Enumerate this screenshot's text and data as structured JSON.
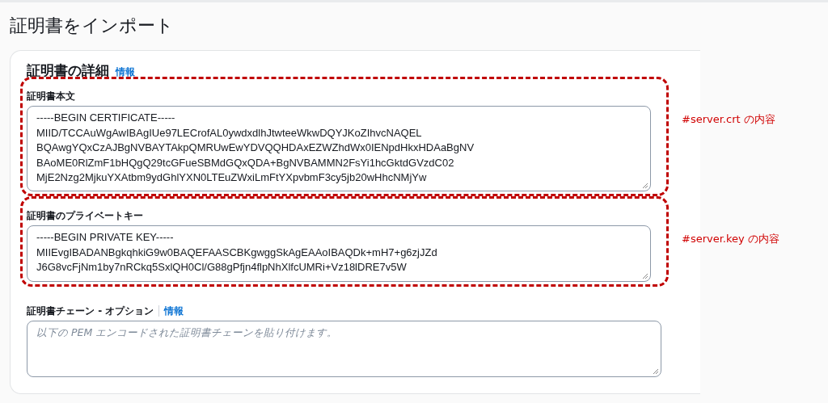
{
  "page": {
    "title": "証明書をインポート"
  },
  "section": {
    "title": "証明書の詳細",
    "info_link": "情報"
  },
  "fields": [
    {
      "label": "証明書本文",
      "value_lines": [
        "-----BEGIN CERTIFICATE-----",
        "MIID/TCCAuWgAwIBAgIUe97LECrofAL0ywdxdlhJtwteeWkwDQYJKoZIhvcNAQEL",
        "BQAwgYQxCzAJBgNVBAYTAkpQMRUwEwYDVQQHDAxEZWZhdWx0IENpdHkxHDAaBgNV",
        "BAoME0RlZmF1bHQgQ29tcGFueSBMdGQxQDA+BgNVBAMMN2FsYi1hcGktdGVzdC02",
        "MjE2Nzg2MjkuYXAtbm9ydGhlYXN0LTEuZWxiLmFtYXpvbmF3cy5jb20wHhcNMjYw"
      ],
      "annotation": "#server.crt の内容"
    },
    {
      "label": "証明書のプライベートキー",
      "value_lines": [
        "-----BEGIN PRIVATE KEY-----",
        "MIIEvgIBADANBgkqhkiG9w0BAQEFAASCBKgwggSkAgEAAoIBAQDk+mH7+g6zjJZd",
        "J6G8vcFjNm1by7nRCkq5SxlQH0Cl/G88gPfjn4flpNhXlfcUMRi+Vz18lDRE7v5W"
      ],
      "annotation": "#server.key の内容"
    },
    {
      "label": "証明書チェーン - オプション",
      "info_link": "情報",
      "placeholder": "以下の PEM エンコードされた証明書チェーンを貼り付けます。"
    }
  ]
}
